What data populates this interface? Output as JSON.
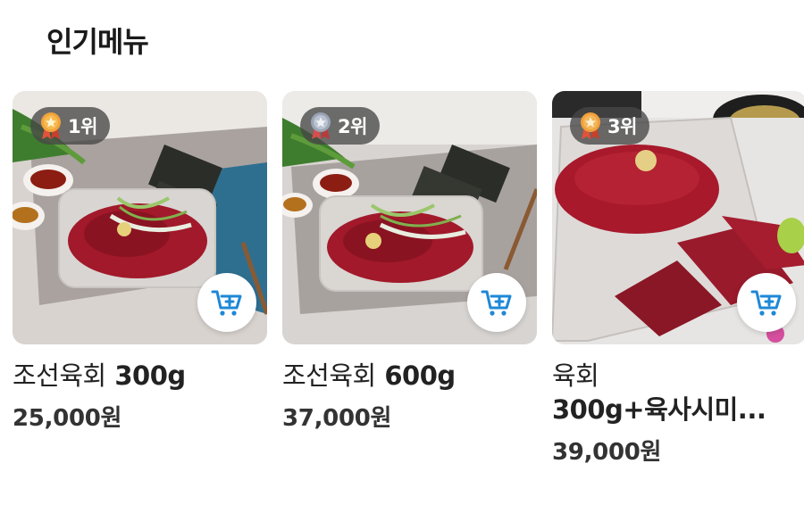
{
  "section": {
    "title": "인기메뉴"
  },
  "products": [
    {
      "rank_label": "1위",
      "medal": "gold",
      "name_main": "조선육회",
      "name_weight": "300g",
      "price": "25,000원",
      "image": "yukhoe-300g-photo",
      "cart_icon": "add-to-cart-icon"
    },
    {
      "rank_label": "2위",
      "medal": "silver",
      "name_main": "조선육회",
      "name_weight": "600g",
      "price": "37,000원",
      "image": "yukhoe-600g-photo",
      "cart_icon": "add-to-cart-icon"
    },
    {
      "rank_label": "3위",
      "medal": "bronze",
      "name_line1": "육회",
      "name_line2": "300g+육사시미...",
      "price": "39,000원",
      "image": "yukhoe-sashimi-set-photo",
      "cart_icon": "add-to-cart-icon"
    }
  ],
  "colors": {
    "accent": "#1e88d6",
    "badge_bg": "#464646",
    "gold": "#f2a33a",
    "silver": "#9aa4b5",
    "bronze": "#f0a03a",
    "ribbon": "#e2533a"
  }
}
